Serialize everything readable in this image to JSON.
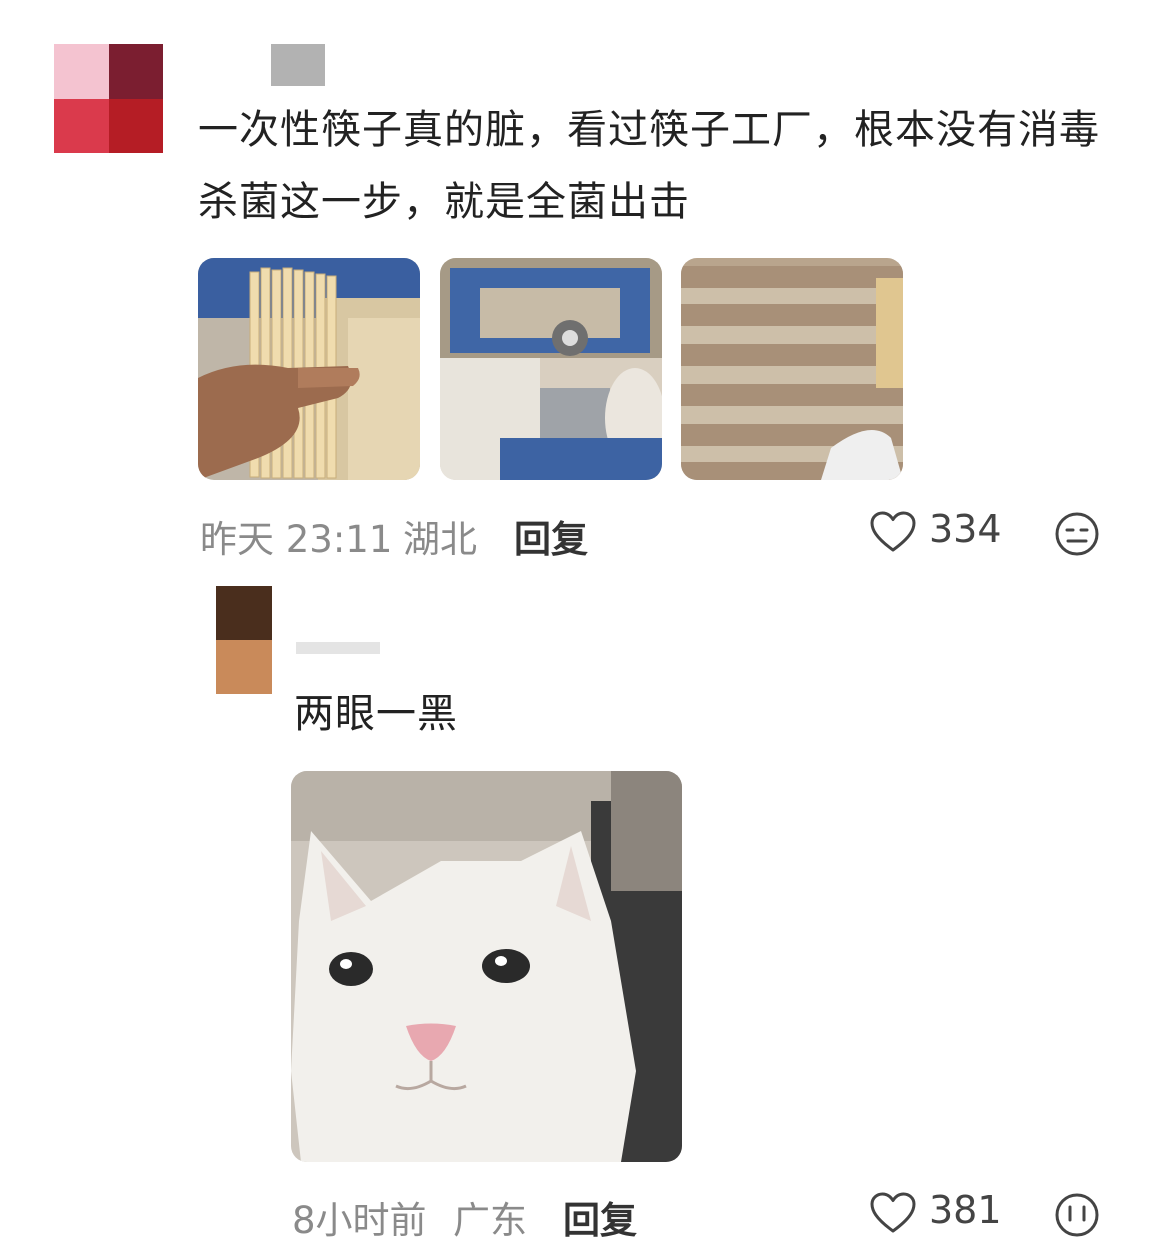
{
  "comment": {
    "text": "一次性筷子真的脏，看过筷子工厂，根本没有消毒杀菌这一步，就是全菌出击",
    "time": "昨天 23:11",
    "location": "湖北",
    "reply_label": "回复",
    "likes": "334",
    "icons": [
      "heart-icon",
      "meh-face-icon"
    ],
    "images": [
      "chopsticks-in-hand",
      "chopstick-machine",
      "chopstick-bundles"
    ]
  },
  "reply": {
    "text": "两眼一黑",
    "time": "8小时前",
    "location": "广东",
    "reply_label": "回复",
    "likes": "381",
    "icons": [
      "heart-icon",
      "face-icon"
    ],
    "image": "white-cat-meme"
  },
  "colors": {
    "avatar1": [
      "#f4c3d0",
      "#7b1e30",
      "#da3a4c",
      "#b51d25"
    ],
    "avatar2": [
      "#4a2e1d",
      "#c98a5a"
    ]
  }
}
